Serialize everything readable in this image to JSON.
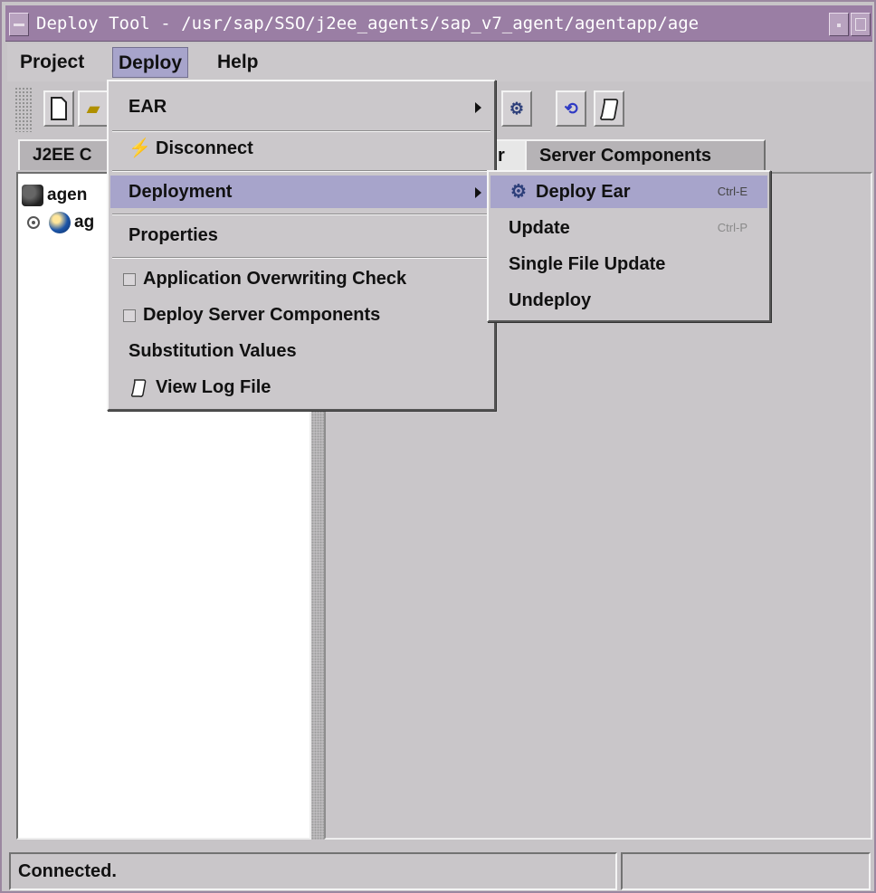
{
  "window": {
    "title": "Deploy Tool - /usr/sap/SSO/j2ee_agents/sap_v7_agent/agentapp/age"
  },
  "menubar": {
    "project": "Project",
    "deploy": "Deploy",
    "help": "Help"
  },
  "tabs": {
    "j2ee": "J2EE C",
    "ear": "r",
    "server": "Server Components"
  },
  "tree": {
    "root_label": "agen",
    "child_label": "ag"
  },
  "deploy_menu": {
    "ear": "EAR",
    "disconnect": "Disconnect",
    "deployment": "Deployment",
    "properties": "Properties",
    "overwriting_check": "Application Overwriting Check",
    "deploy_server_components": "Deploy Server Components",
    "substitution_values": "Substitution Values",
    "view_log_file": "View Log File"
  },
  "deployment_submenu": {
    "deploy_ear": "Deploy Ear",
    "deploy_ear_accel": "Ctrl-E",
    "update": "Update",
    "update_accel": "Ctrl-P",
    "single_file_update": "Single File Update",
    "undeploy": "Undeploy"
  },
  "status": {
    "text": "Connected."
  },
  "colors": {
    "title_bar": "#9a7ea4",
    "menu_highlight": "#a7a4cb",
    "background": "#c9c6c9"
  }
}
